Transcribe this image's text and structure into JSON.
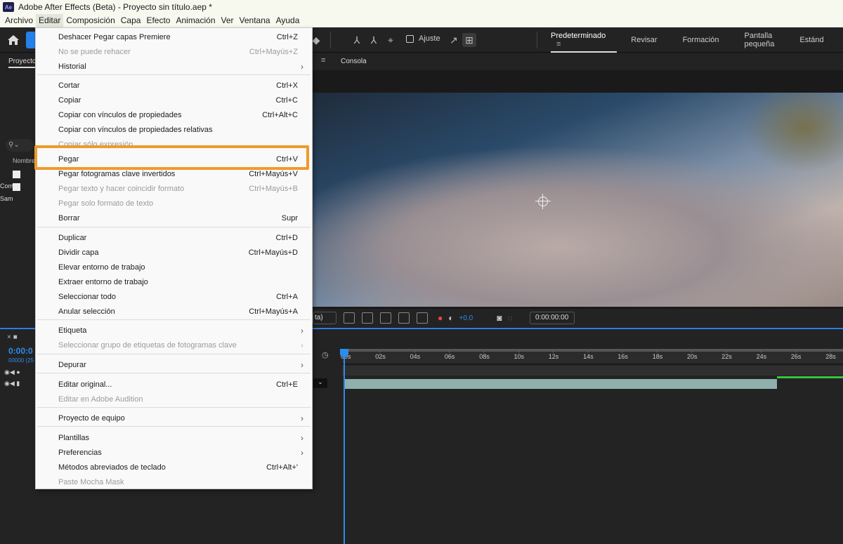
{
  "window": {
    "title": "Adobe After Effects (Beta) - Proyecto sin título.aep *",
    "app_icon": "Ae"
  },
  "menubar": [
    "Archivo",
    "Editar",
    "Composición",
    "Capa",
    "Efecto",
    "Animación",
    "Ver",
    "Ventana",
    "Ayuda"
  ],
  "toolbar": {
    "ajuste_label": "Ajuste"
  },
  "workspaces": [
    "Predeterminado",
    "Revisar",
    "Formación",
    "Pantalla pequeña",
    "Estánd"
  ],
  "project": {
    "tab": "Proyecto",
    "col_name": "Nombre",
    "rows": [
      "Com",
      "Sam"
    ]
  },
  "viewer": {
    "tab_consola": "Consola",
    "view_select": "ta)",
    "exposure": "+0.0",
    "timecode": "0:00:00:00"
  },
  "timeline": {
    "timecode": "0:00:0",
    "frames": "00000 (25",
    "ticks": [
      "00s",
      "02s",
      "04s",
      "06s",
      "08s",
      "10s",
      "12s",
      "14s",
      "16s",
      "18s",
      "20s",
      "22s",
      "24s",
      "26s",
      "28s"
    ]
  },
  "edit_menu": {
    "groups": [
      [
        {
          "label": "Deshacer Pegar capas Premiere",
          "shortcut": "Ctrl+Z"
        },
        {
          "label": "No se puede rehacer",
          "shortcut": "Ctrl+Mayús+Z",
          "disabled": true
        },
        {
          "label": "Historial",
          "submenu": true
        }
      ],
      [
        {
          "label": "Cortar",
          "shortcut": "Ctrl+X"
        },
        {
          "label": "Copiar",
          "shortcut": "Ctrl+C"
        },
        {
          "label": "Copiar con vínculos de propiedades",
          "shortcut": "Ctrl+Alt+C"
        },
        {
          "label": "Copiar con vínculos de propiedades relativas"
        },
        {
          "label": "Copiar sólo expresión",
          "disabled": true
        },
        {
          "label": "Pegar",
          "shortcut": "Ctrl+V"
        },
        {
          "label": "Pegar fotogramas clave invertidos",
          "shortcut": "Ctrl+Mayús+V"
        },
        {
          "label": "Pegar texto y hacer coincidir formato",
          "shortcut": "Ctrl+Mayús+B",
          "disabled": true
        },
        {
          "label": "Pegar solo formato de texto",
          "disabled": true
        },
        {
          "label": "Borrar",
          "shortcut": "Supr"
        }
      ],
      [
        {
          "label": "Duplicar",
          "shortcut": "Ctrl+D"
        },
        {
          "label": "Dividir capa",
          "shortcut": "Ctrl+Mayús+D"
        },
        {
          "label": "Elevar entorno de trabajo"
        },
        {
          "label": "Extraer entorno de trabajo"
        },
        {
          "label": "Seleccionar todo",
          "shortcut": "Ctrl+A"
        },
        {
          "label": "Anular selección",
          "shortcut": "Ctrl+Mayús+A"
        }
      ],
      [
        {
          "label": "Etiqueta",
          "submenu": true
        },
        {
          "label": "Seleccionar grupo de etiquetas de fotogramas clave",
          "submenu": true,
          "disabled": true
        }
      ],
      [
        {
          "label": "Depurar",
          "submenu": true
        }
      ],
      [
        {
          "label": "Editar original...",
          "shortcut": "Ctrl+E"
        },
        {
          "label": "Editar en Adobe Audition",
          "disabled": true
        }
      ],
      [
        {
          "label": "Proyecto de equipo",
          "submenu": true
        }
      ],
      [
        {
          "label": "Plantillas",
          "submenu": true
        },
        {
          "label": "Preferencias",
          "submenu": true
        },
        {
          "label": "Métodos abreviados de teclado",
          "shortcut": "Ctrl+Alt+'"
        },
        {
          "label": "Paste Mocha Mask",
          "disabled": true
        }
      ]
    ],
    "highlighted": "Pegar"
  },
  "colors": {
    "accent": "#2680eb",
    "highlight_border": "#ee9b2a",
    "menu_bg": "#f9f9f9",
    "layer_bar": "#8fb0ad"
  }
}
